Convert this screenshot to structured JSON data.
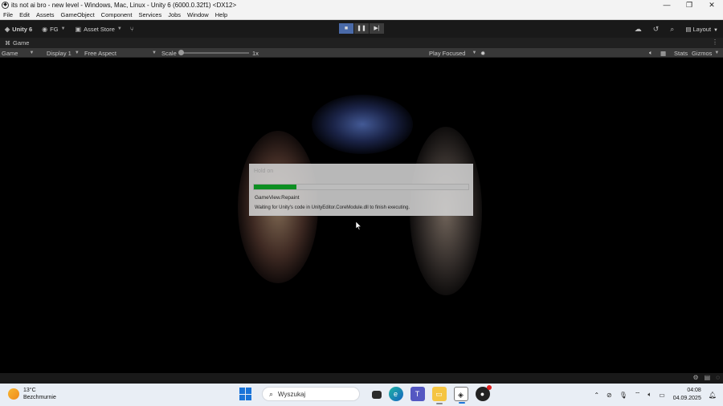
{
  "window": {
    "title": "its not ai bro - new level - Windows, Mac, Linux - Unity 6 (6000.0.32f1) <DX12>"
  },
  "menu": [
    "File",
    "Edit",
    "Assets",
    "GameObject",
    "Component",
    "Services",
    "Jobs",
    "Window",
    "Help"
  ],
  "toolbar": {
    "unity_label": "Unity 6",
    "account_label": "FG",
    "asset_store_label": "Asset Store",
    "layout_label": "Layout"
  },
  "tab": {
    "label": "Game"
  },
  "gamebar": {
    "mode": "Game",
    "display": "Display 1",
    "aspect": "Free Aspect",
    "scale_label": "Scale",
    "scale_value": "1x",
    "play_focus": "Play Focused",
    "stats": "Stats",
    "gizmos": "Gizmos"
  },
  "dialog": {
    "title": "Hold on",
    "progress": 0.2,
    "line1": "GameView.Repaint",
    "line2": "Waiting for Unity's code in UnityEditor.CoreModule.dll to finish executing."
  },
  "taskbar": {
    "temperature": "13°C",
    "weather": "Bezchmurnie",
    "search_placeholder": "Wyszukaj",
    "time": "04:08",
    "date": "04.09.2025"
  },
  "colors": {
    "progress_fill": "#0d8f22",
    "play_active": "#4a6aa8",
    "windows_blue": "#1a74d8"
  }
}
